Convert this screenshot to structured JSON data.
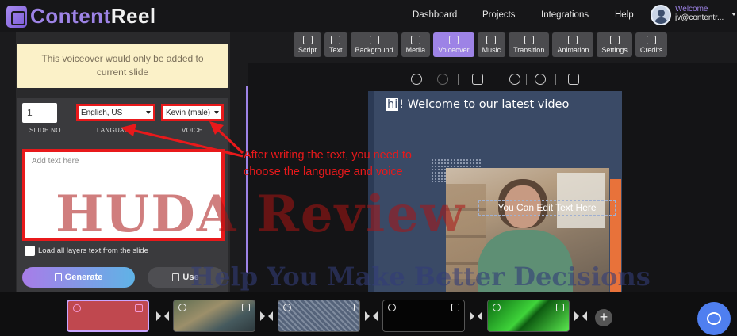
{
  "header": {
    "logo_content": "Content",
    "logo_reel": "Reel",
    "nav": [
      "Dashboard",
      "Projects",
      "Integrations",
      "Help"
    ],
    "welcome": "Welcome",
    "email": "jv@contentr..."
  },
  "toolbar": {
    "tabs": [
      "Script",
      "Text",
      "Background",
      "Media",
      "Voiceover",
      "Music",
      "Transition",
      "Animation",
      "Settings",
      "Credits"
    ],
    "active": "Voiceover"
  },
  "voiceover": {
    "notice": "This voiceover would only be added to current slide",
    "slide_no_value": "1",
    "slide_no_label": "SLIDE NO.",
    "language_value": "English, US",
    "language_label": "LANGUAGE",
    "voice_value": "Kevin (male)",
    "voice_label": "VOICE",
    "text_placeholder": "Add text here",
    "load_layers_label": "Load all layers text from the slide",
    "generate_label": "Generate",
    "use_label": "Use"
  },
  "slide": {
    "title_hi": "hi",
    "title_rest": "! Welcome to our latest video",
    "edit_text": "You Can Edit Text Here"
  },
  "annotation": {
    "text": "After writing the text, you need to choose the language and voice",
    "color": "#e8191b"
  },
  "watermark": {
    "line1": "HUDA Review",
    "line2": "Help You Make Better Decisions"
  },
  "timeline": {
    "add_label": "+"
  },
  "colors": {
    "accent": "#9d83e6",
    "highlight": "#e8191b",
    "chat": "#4f7ff0"
  }
}
